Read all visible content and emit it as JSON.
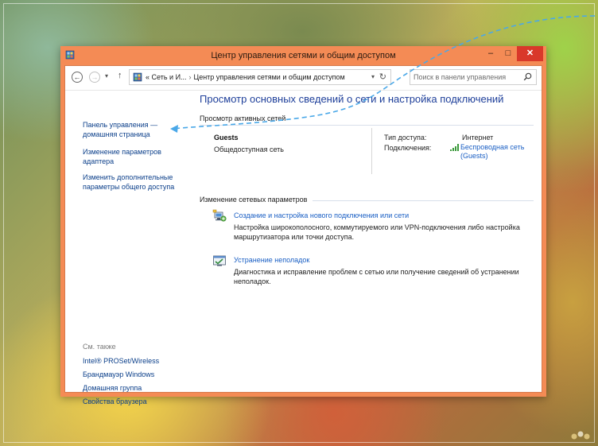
{
  "window": {
    "title": "Центр управления сетями и общим доступом",
    "min_glyph": "–",
    "max_glyph": "□",
    "close_glyph": "✕"
  },
  "addressbar": {
    "back_glyph": "←",
    "forward_glyph": "→",
    "dropdown_glyph": "▾",
    "up_glyph": "↑",
    "breadcrumb_prefix": "«",
    "breadcrumb_parent": "Сеть и И...",
    "breadcrumb_separator": "›",
    "breadcrumb_current": "Центр управления сетями и общим доступом",
    "path_dropdown_glyph": "▾",
    "refresh_glyph": "↻",
    "search_placeholder": "Поиск в панели управления"
  },
  "sidebar": {
    "links": [
      "Панель управления — домашняя страница",
      "Изменение параметров адаптера",
      "Изменить дополнительные параметры общего доступа"
    ],
    "see_also_title": "См. также",
    "see_also_links": [
      "Intel® PROSet/Wireless",
      "Брандмауэр Windows",
      "Домашняя группа",
      "Свойства браузера"
    ]
  },
  "main": {
    "heading": "Просмотр основных сведений о сети и настройка подключений",
    "active_networks_label": "Просмотр активных сетей",
    "network": {
      "name": "Guests",
      "type": "Общедоступная сеть",
      "access_type_label": "Тип доступа:",
      "access_type_value": "Интернет",
      "connections_label": "Подключения:",
      "connection_link": "Беспроводная сеть (Guests)"
    },
    "change_settings_label": "Изменение сетевых параметров",
    "tasks": [
      {
        "icon": "network-setup-icon",
        "link": "Создание и настройка нового подключения или сети",
        "description": "Настройка широкополосного, коммутируемого или VPN-подключения либо настройка маршрутизатора или точки доступа."
      },
      {
        "icon": "troubleshoot-icon",
        "link": "Устранение неполадок",
        "description": "Диагностика и исправление проблем с сетью или получение сведений об устранении неполадок."
      }
    ]
  },
  "colors": {
    "window_frame": "#f48b55",
    "close_button": "#d9382a",
    "link_blue": "#1a5fc4",
    "heading_blue": "#1e3f9a",
    "callout_arrow": "#4aa8e8"
  }
}
